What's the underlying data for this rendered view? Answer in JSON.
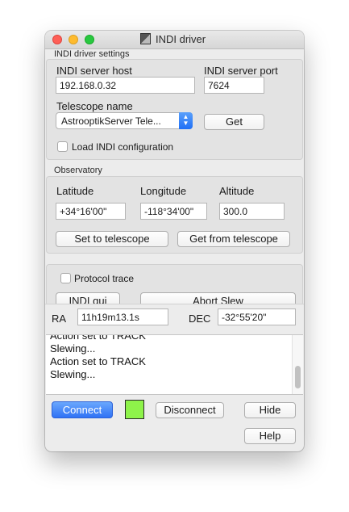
{
  "window": {
    "title": "INDI driver"
  },
  "settings": {
    "group_title": "INDI driver settings",
    "host_label": "INDI server host",
    "host_value": "192.168.0.32",
    "port_label": "INDI server port",
    "port_value": "7624",
    "telescope_label": "Telescope name",
    "telescope_value": "AstrooptikServer Tele...",
    "get_button": "Get",
    "load_config_label": "Load INDI configuration",
    "load_config_checked": false
  },
  "observatory": {
    "group_title": "Observatory",
    "latitude_label": "Latitude",
    "longitude_label": "Longitude",
    "altitude_label": "Altitude",
    "latitude_value": "+34°16'00\"",
    "longitude_value": "-118°34'00\"",
    "altitude_value": "300.0",
    "set_button": "Set to telescope",
    "get_button": "Get from telescope"
  },
  "controls": {
    "protocol_trace_label": "Protocol trace",
    "protocol_trace_checked": false,
    "indi_gui_button": "INDI gui",
    "abort_button": "Abort Slew"
  },
  "coords": {
    "ra_label": "RA",
    "ra_value": "11h19m13.1s",
    "dec_label": "DEC",
    "dec_value": "-32°55'20\""
  },
  "log": {
    "lines": [
      "Action set to TRACK",
      "Slewing...",
      "Action set to TRACK",
      "Slewing..."
    ]
  },
  "footer": {
    "connect_button": "Connect",
    "status_color": "#8ef34a",
    "disconnect_button": "Disconnect",
    "hide_button": "Hide",
    "help_button": "Help"
  }
}
